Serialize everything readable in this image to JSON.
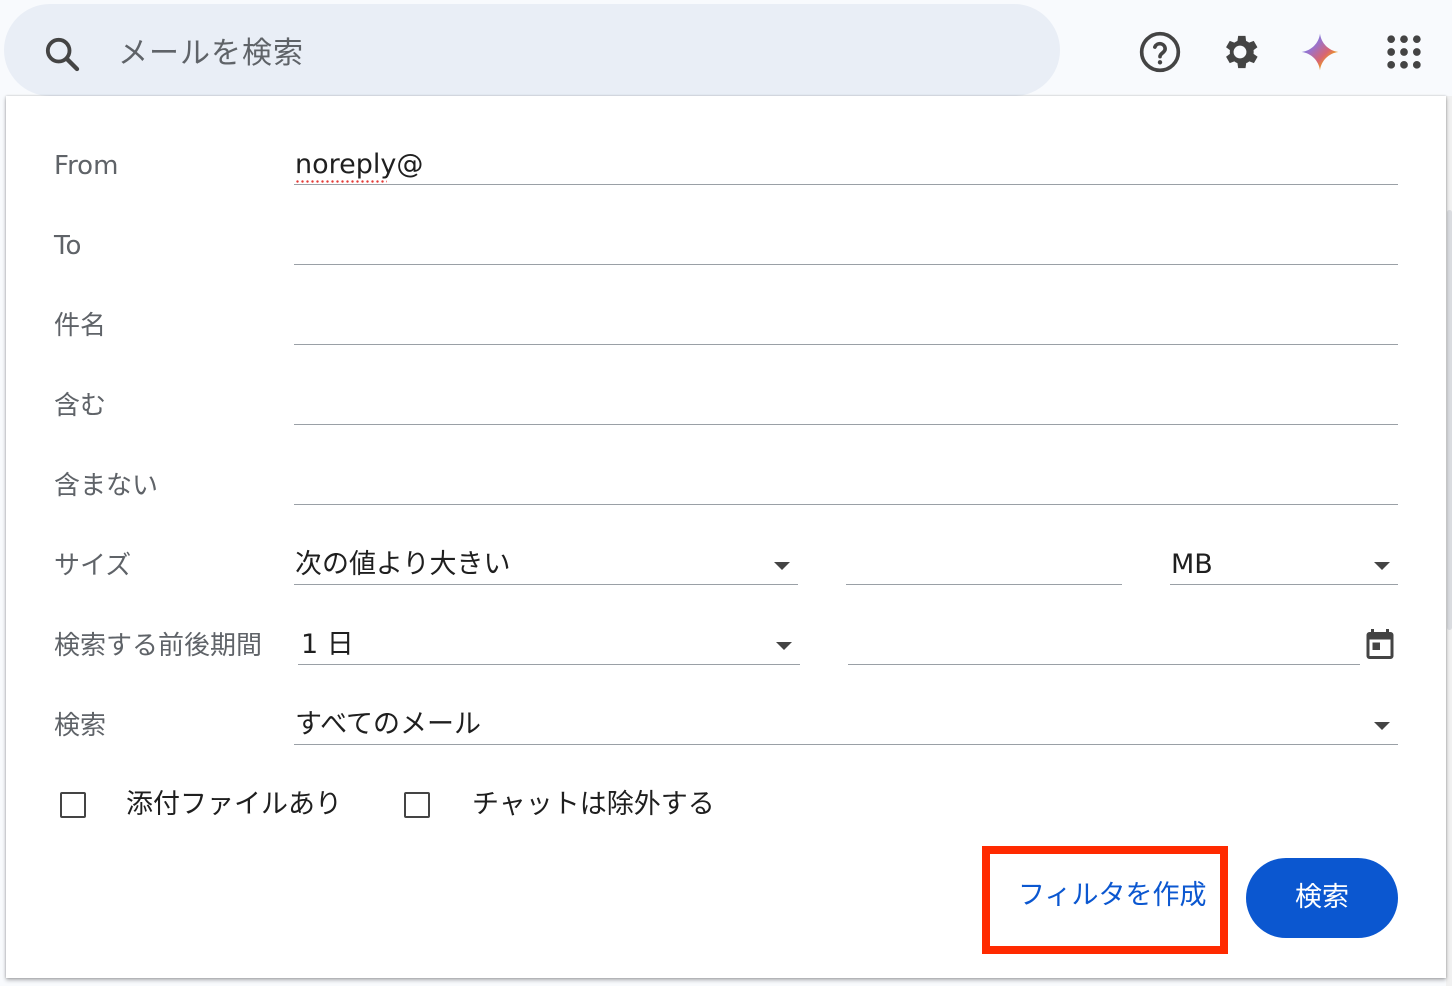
{
  "search": {
    "placeholder": "メールを検索"
  },
  "top_icons": [
    "help-icon",
    "settings-icon",
    "gemini-icon",
    "apps-grid-icon"
  ],
  "colors": {
    "accent": "#0b57d0",
    "highlight_box": "#ff2a00",
    "search_bg": "#e9eef6"
  },
  "panel": {
    "from_label": "From",
    "from_value": "noreply@",
    "to_label": "To",
    "to_value": "",
    "subject_label": "件名",
    "subject_value": "",
    "has_words_label": "含む",
    "has_words_value": "",
    "doesnt_have_label": "含まない",
    "doesnt_have_value": "",
    "size_label": "サイズ",
    "size_operator": "次の値より大きい",
    "size_value": "",
    "size_unit": "MB",
    "date_within_label": "検索する前後期間",
    "date_within_value": "1 日",
    "date_value": "",
    "search_in_label": "検索",
    "search_in_value": "すべてのメール",
    "has_attachment_label": "添付ファイルあり",
    "has_attachment_checked": false,
    "exclude_chats_label": "チャットは除外する",
    "exclude_chats_checked": false,
    "create_filter_label": "フィルタを作成",
    "search_button_label": "検索"
  }
}
